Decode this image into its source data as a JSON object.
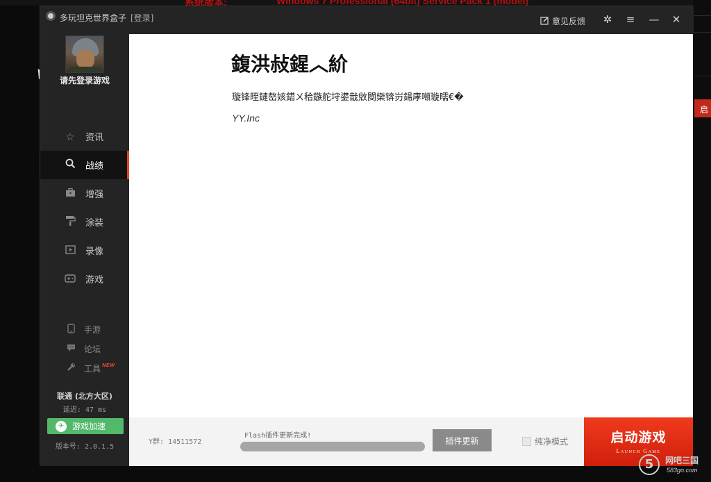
{
  "background": {
    "partial_text_left": "系统版本:",
    "partial_text_main": "Windows 7 Professional (64bit) Service Pack 1 (model)",
    "right_button_partial": "启"
  },
  "app": {
    "title": "多玩坦克世界盒子",
    "login_link": "[登录]",
    "feedback_label": "意见反馈",
    "icons": [
      "edit-icon",
      "gear-icon",
      "menu-icon",
      "minimize-icon",
      "close-icon"
    ]
  },
  "sidebar": {
    "login_hint": "请先登录游戏",
    "nav": [
      {
        "label": "资讯",
        "icon": "star-icon",
        "active": false
      },
      {
        "label": "战绩",
        "icon": "search-icon",
        "active": true
      },
      {
        "label": "增强",
        "icon": "briefcase-icon",
        "active": false
      },
      {
        "label": "涂装",
        "icon": "paint-roller-icon",
        "active": false
      },
      {
        "label": "录像",
        "icon": "video-icon",
        "active": false
      },
      {
        "label": "游戏",
        "icon": "gamepad-icon",
        "active": false
      }
    ],
    "sub_nav": [
      {
        "label": "手游",
        "icon": "phone-icon"
      },
      {
        "label": "论坛",
        "icon": "chat-icon"
      },
      {
        "label": "工具",
        "icon": "wrench-icon",
        "badge": "NEW"
      }
    ],
    "server": "联通 (北方大区)",
    "latency": "延迟: 47 ms",
    "accelerate_label": "游戏加速",
    "version": "版本号: 2.0.1.5"
  },
  "content": {
    "title": "鍑洪敊鍟︿紒",
    "message": "璇锋眰鏈嶅姟鍣ㄨ秴鏃舵垨鍙戠敓閿欒锛岃鍚庨噸璇曘€�",
    "signature": "YY.Inc"
  },
  "bottom": {
    "qq_group": "Y群: 14511572",
    "flash_status": "Flash插件更新完成!",
    "progress": 1.0,
    "plugin_update_label": "插件更新",
    "pure_mode_label": "纯净模式",
    "launch_label": "启动游戏",
    "launch_sub": "Launch Game"
  },
  "watermark": {
    "glyph": "5",
    "name": "网吧三国",
    "site": "583go.com"
  },
  "colors": {
    "accent": "#e8431f",
    "launch_red": "#e32b16",
    "accelerate_green": "#52b86a",
    "sidebar_bg": "#242424"
  }
}
